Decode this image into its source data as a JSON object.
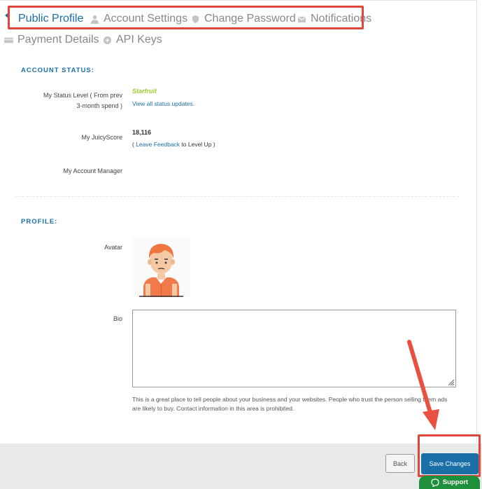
{
  "tabs": [
    {
      "label": "Public Profile",
      "icon": "caret-left-icon",
      "active": true
    },
    {
      "label": "Account Settings",
      "icon": "user-icon"
    },
    {
      "label": "Change Password",
      "icon": "shield-icon"
    },
    {
      "label": "Notifications",
      "icon": "envelope-icon"
    },
    {
      "label": "Payment Details",
      "icon": "card-icon"
    },
    {
      "label": "API Keys",
      "icon": "plus-circle-icon"
    }
  ],
  "account_status": {
    "title": "ACCOUNT STATUS:",
    "status_label_line1": "My Status Level ( From prev",
    "status_label_line2": "3-month spend )",
    "status_value": "Starfruit",
    "status_link": "View all status updates.",
    "juicyscore_label": "My JuicyScore",
    "juicyscore_value": "18,116",
    "feedback_prefix": "( ",
    "feedback_link": "Leave Feedback",
    "feedback_suffix": " to Level Up )",
    "manager_label": "My Account Manager"
  },
  "profile": {
    "title": "PROFILE:",
    "avatar_label": "Avatar",
    "bio_label": "Bio",
    "bio_value": "",
    "help_text": "This is a great place to tell people about your business and your websites. People who trust the person selling them ads are likely to buy. Contact information in this area is prohibited."
  },
  "footer": {
    "back_label": "Back",
    "save_label": "Save Changes",
    "support_label": "Support"
  },
  "colors": {
    "accent": "#1a6fa8",
    "highlight": "#e0463c",
    "status_green": "#9acd32",
    "support_green": "#1e8f3a"
  }
}
